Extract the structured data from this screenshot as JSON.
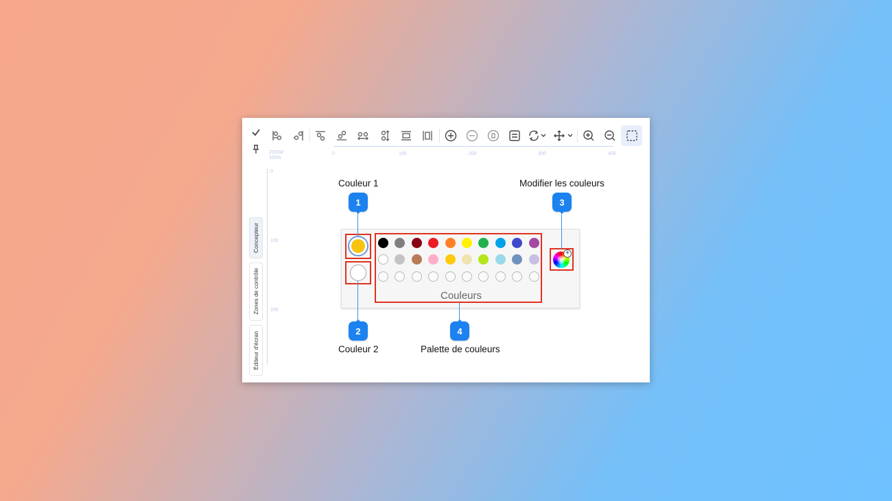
{
  "window": {
    "toolbar": {
      "tools": [
        {
          "icon": "checkmark-icon"
        },
        {
          "icon": "pin-icon"
        },
        {
          "icon": "align-left-icon"
        },
        {
          "icon": "align-center-h-icon"
        },
        {
          "icon": "align-top-icon"
        },
        {
          "icon": "align-bottom-icon"
        },
        {
          "icon": "distribute-h-icon"
        },
        {
          "icon": "distribute-v-icon"
        },
        {
          "icon": "same-width-icon"
        },
        {
          "icon": "same-height-icon"
        },
        {
          "icon": "add-circle-icon"
        },
        {
          "icon": "remove-circle-icon"
        },
        {
          "icon": "delete-circle-icon"
        },
        {
          "icon": "properties-icon"
        },
        {
          "icon": "rotate-icon"
        },
        {
          "icon": "move-icon"
        },
        {
          "icon": "zoom-in-icon"
        },
        {
          "icon": "zoom-out-icon"
        },
        {
          "icon": "select-area-icon"
        }
      ]
    },
    "ruler": {
      "zoom_label": "ZOOM",
      "zoom_value": "100%",
      "h_ticks": [
        "0",
        "100",
        "200",
        "300",
        "400"
      ],
      "v_ticks": [
        "0",
        "100",
        "200"
      ]
    },
    "side_tabs": [
      "Concepteur",
      "Zones de contrôle",
      "Éditeur d'écran"
    ],
    "panel": {
      "color1": "#f7c30f",
      "color2": "#ffffff",
      "palette_row1": [
        "#000000",
        "#7f7f7f",
        "#880015",
        "#ed1c24",
        "#ff7f27",
        "#fff200",
        "#22b14c",
        "#00a2e8",
        "#3f48cc",
        "#a349a4"
      ],
      "palette_row2": [
        "#ffffff",
        "#c3c3c3",
        "#b97a57",
        "#ffaec9",
        "#ffc90e",
        "#efe4b0",
        "#b5e61d",
        "#99d9ea",
        "#7092be",
        "#c8bfe7"
      ],
      "group_label": "Couleurs"
    },
    "callouts": [
      {
        "number": "1",
        "label": "Couleur 1"
      },
      {
        "number": "2",
        "label": "Couleur 2"
      },
      {
        "number": "3",
        "label": "Modifier les couleurs"
      },
      {
        "number": "4",
        "label": "Palette de couleurs"
      }
    ]
  }
}
